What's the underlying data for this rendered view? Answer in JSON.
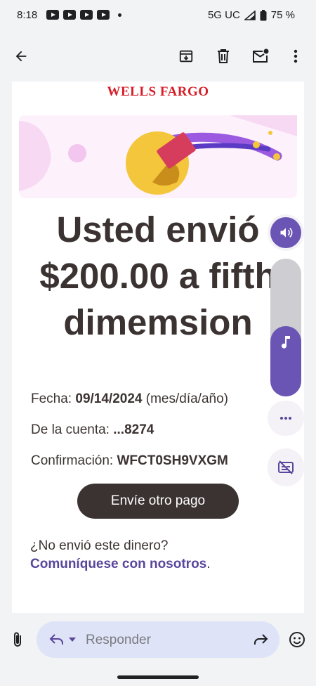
{
  "status_bar": {
    "time": "8:18",
    "network": "5G UC",
    "battery": "75 %"
  },
  "email": {
    "brand": "WELLS FARGO",
    "headline_lines": [
      "Usted envió",
      "$200.00 a fifth",
      "dimemsion"
    ],
    "date_label": "Fecha: ",
    "date_value": "09/14/2024",
    "date_format": " (mes/día/año)",
    "account_label": "De la cuenta: ",
    "account_value": "...8274",
    "confirmation_label": "Confirmación: ",
    "confirmation_value": "WFCT0SH9VXGM",
    "cta_label": "Envíe otro pago",
    "not_sent_text": "¿No envió este dinero?",
    "contact_link": "Comuníquese con nosotros",
    "contact_period": "."
  },
  "reply_bar": {
    "placeholder": "Responder"
  },
  "colors": {
    "brand_red": "#d71e28",
    "accent_purple": "#5a469b",
    "text_dark": "#3b3331"
  }
}
